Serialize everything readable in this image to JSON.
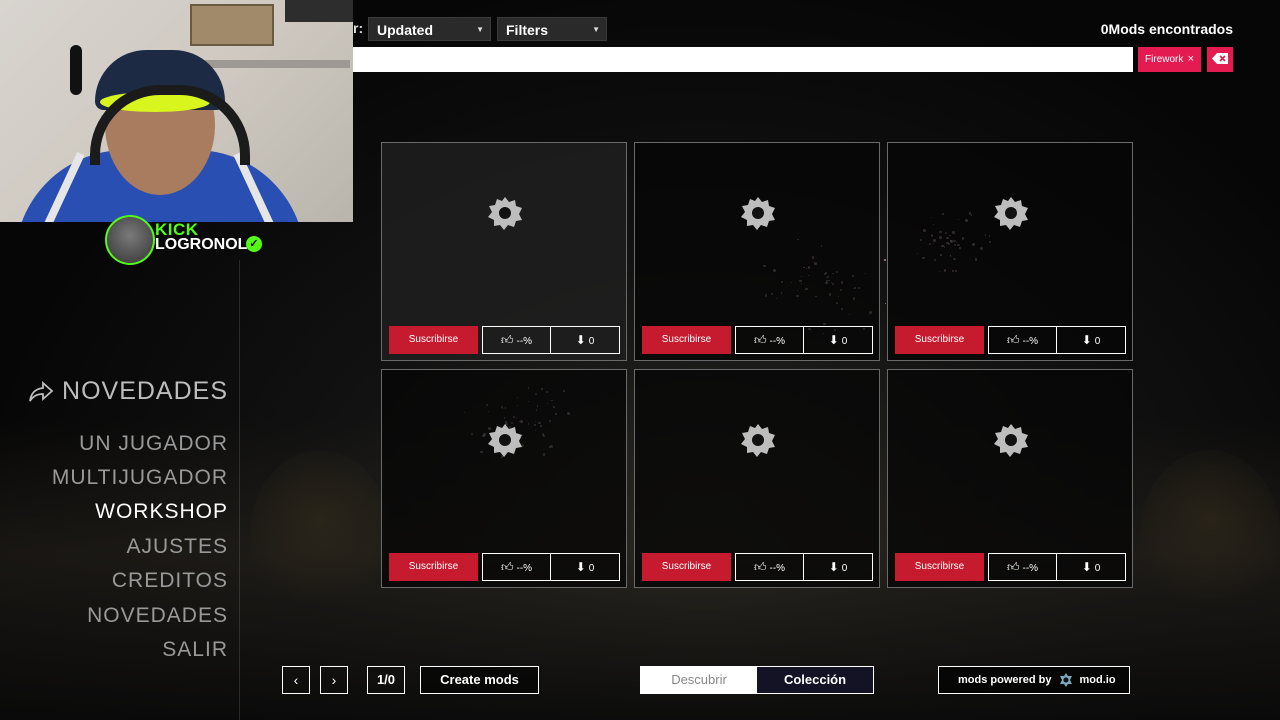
{
  "stream": {
    "platform_logo": "KICK",
    "channel_name": "LOGRONOL",
    "verified_icon": "check-icon"
  },
  "topbar": {
    "sort_label": "r:",
    "sort_value": "Updated",
    "filters_label": "Filters",
    "mods_found": "0Mods encontrados",
    "search_value": "",
    "tag_label": "Firework",
    "tag_remove": "×"
  },
  "menu": {
    "header": "NOVEDADES",
    "items": [
      {
        "label": "UN JUGADOR"
      },
      {
        "label": "MULTIJUGADOR"
      },
      {
        "label": "WORKSHOP"
      },
      {
        "label": "AJUSTES"
      },
      {
        "label": "CREDITOS"
      },
      {
        "label": "NOVEDADES"
      },
      {
        "label": "SALIR"
      }
    ]
  },
  "cards": [
    {
      "subscribe": "Suscribirse",
      "likes": "--%",
      "downloads": "0"
    },
    {
      "subscribe": "Suscribirse",
      "likes": "--%",
      "downloads": "0"
    },
    {
      "subscribe": "Suscribirse",
      "likes": "--%",
      "downloads": "0"
    },
    {
      "subscribe": "Suscribirse",
      "likes": "--%",
      "downloads": "0"
    },
    {
      "subscribe": "Suscribirse",
      "likes": "--%",
      "downloads": "0"
    },
    {
      "subscribe": "Suscribirse",
      "likes": "--%",
      "downloads": "0"
    }
  ],
  "bottom": {
    "prev": "‹",
    "next": "›",
    "page": "1/0",
    "create_mods": "Create mods",
    "tab_discover": "Descubrir",
    "tab_collection": "Colección",
    "powered_by": "mods powered by",
    "modio": "mod.io"
  },
  "colors": {
    "accent_red": "#c61a2f",
    "tag_pink": "#e31b50",
    "kick_green": "#53fc18"
  }
}
